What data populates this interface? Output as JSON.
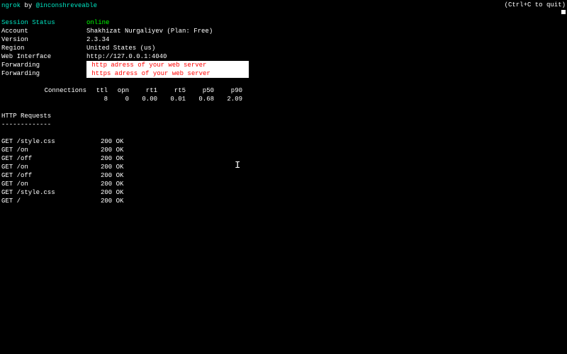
{
  "header": {
    "app": "ngrok",
    "by": " by ",
    "author": "@inconshreveable",
    "quit_hint": "(Ctrl+C to quit)"
  },
  "status": {
    "labels": {
      "session_status": "Session Status",
      "account": "Account",
      "version": "Version",
      "region": "Region",
      "web_interface": "Web Interface",
      "forwarding1": "Forwarding",
      "forwarding2": "Forwarding"
    },
    "values": {
      "session_status": "online",
      "account": "Shakhizat Nurgaliyev (Plan: Free)",
      "version": "2.3.34",
      "region": "United States (us)",
      "web_interface": "http://127.0.0.1:4040",
      "forwarding_http": " http adress of your web server",
      "forwarding_https": " https adress of your web server"
    }
  },
  "connections": {
    "label": "Connections",
    "headers": {
      "ttl": "ttl",
      "opn": "opn",
      "rt1": "rt1",
      "rt5": "rt5",
      "p50": "p50",
      "p90": "p90"
    },
    "values": {
      "ttl": "8",
      "opn": "0",
      "rt1": "0.00",
      "rt5": "0.01",
      "p50": "0.68",
      "p90": "2.09"
    }
  },
  "http": {
    "title": "HTTP Requests",
    "sep": "-------------",
    "rows": [
      {
        "req": "GET /style.css",
        "status": "200 OK"
      },
      {
        "req": "GET /on",
        "status": "200 OK"
      },
      {
        "req": "GET /off",
        "status": "200 OK"
      },
      {
        "req": "GET /on",
        "status": "200 OK"
      },
      {
        "req": "GET /off",
        "status": "200 OK"
      },
      {
        "req": "GET /on",
        "status": "200 OK"
      },
      {
        "req": "GET /style.css",
        "status": "200 OK"
      },
      {
        "req": "GET /",
        "status": "200 OK"
      }
    ]
  }
}
